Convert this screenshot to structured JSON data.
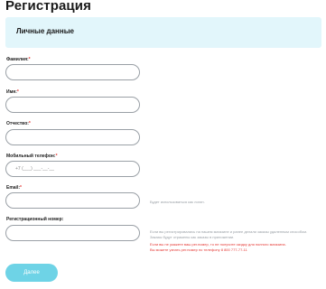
{
  "page": {
    "title": "Регистрация"
  },
  "section": {
    "title": "Личные данные"
  },
  "fields": {
    "last_name": {
      "label": "Фамилия:",
      "required_mark": "*",
      "value": "",
      "placeholder": ""
    },
    "first_name": {
      "label": "Имя:",
      "required_mark": "*",
      "value": "",
      "placeholder": ""
    },
    "middle_name": {
      "label": "Отчество:",
      "required_mark": "*",
      "value": "",
      "placeholder": ""
    },
    "phone": {
      "label": "Мобильный телефон:",
      "required_mark": "*",
      "value": "",
      "placeholder": "+7 (___) ___-__-__"
    },
    "email": {
      "label": "Email:",
      "required_mark": "*",
      "value": "",
      "placeholder": ""
    },
    "registration_number": {
      "label": "Регистрационный номер:",
      "required_mark": "",
      "value": "",
      "placeholder": ""
    }
  },
  "hints": {
    "email_hint": "Будет использоваться как логин.",
    "reg_hint_1": "Если вы регистрировались на нашем магазине и ранее делали заказы удаленным способом.",
    "reg_hint_2": "Заказы будут отражены как заказы в приложении.",
    "reg_error_1": "Если вы не укажете ваш рег.номер, то не получите скидку для полного магазина.",
    "reg_error_2": "Вы можете узнать рег.номер по телефону 8 800 777-77-11"
  },
  "actions": {
    "submit_label": "Далее"
  },
  "colors": {
    "banner_bg": "#e2f6fb",
    "button_bg": "#6ed3e6",
    "required": "#e53935",
    "error": "#e53935"
  }
}
